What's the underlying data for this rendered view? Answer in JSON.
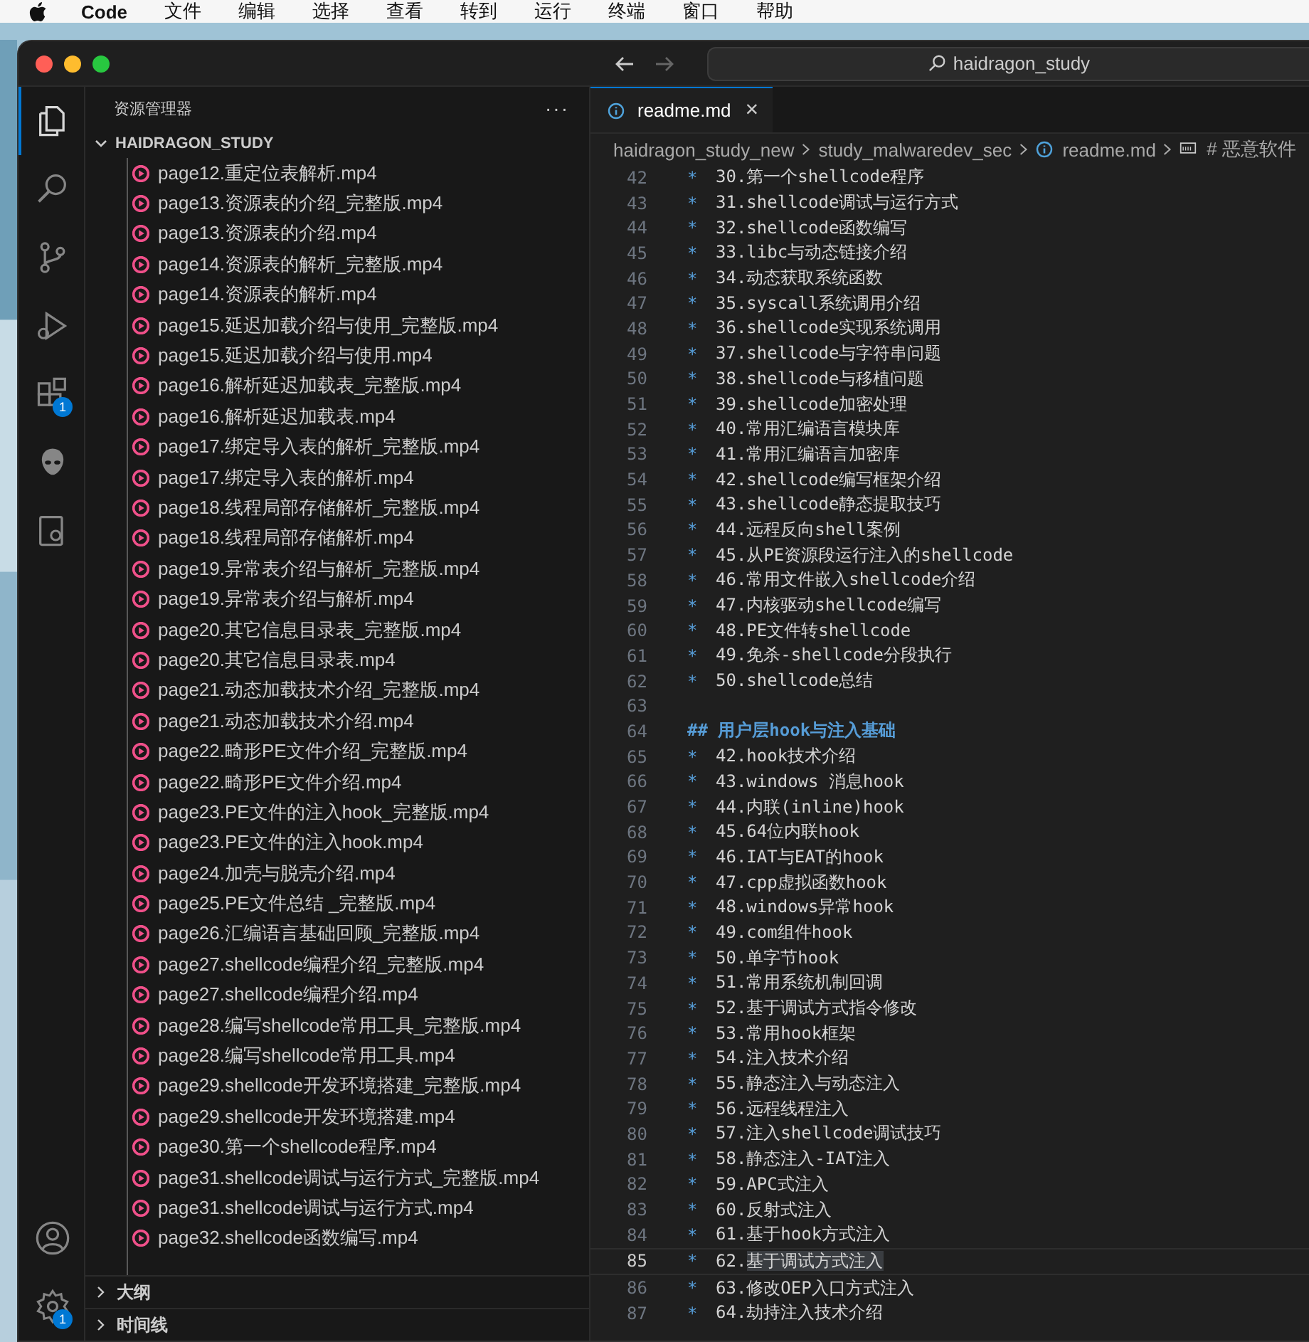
{
  "menu_bar": {
    "app": "Code",
    "items": [
      "文件",
      "编辑",
      "选择",
      "查看",
      "转到",
      "运行",
      "终端",
      "窗口",
      "帮助"
    ]
  },
  "title_bar": {
    "search": "haidragon_study"
  },
  "activity_bar": [
    {
      "kind": "explorer",
      "selected": true
    },
    {
      "kind": "search",
      "selected": false
    },
    {
      "kind": "source-control",
      "selected": false
    },
    {
      "kind": "run",
      "selected": false
    },
    {
      "kind": "extensions",
      "selected": false,
      "badge": "1"
    },
    {
      "kind": "alien",
      "selected": false
    },
    {
      "kind": "remote",
      "selected": false
    }
  ],
  "activity_bottom": [
    {
      "kind": "account"
    },
    {
      "kind": "settings",
      "badge": "1"
    }
  ],
  "sidebar": {
    "title": "资源管理器",
    "more": "···",
    "folder": "HAIDRAGON_STUDY",
    "files": [
      "page12.重定位表解析.mp4",
      "page13.资源表的介绍_完整版.mp4",
      "page13.资源表的介绍.mp4",
      "page14.资源表的解析_完整版.mp4",
      "page14.资源表的解析.mp4",
      "page15.延迟加载介绍与使用_完整版.mp4",
      "page15.延迟加载介绍与使用.mp4",
      "page16.解析延迟加载表_完整版.mp4",
      "page16.解析延迟加载表.mp4",
      "page17.绑定导入表的解析_完整版.mp4",
      "page17.绑定导入表的解析.mp4",
      "page18.线程局部存储解析_完整版.mp4",
      "page18.线程局部存储解析.mp4",
      "page19.异常表介绍与解析_完整版.mp4",
      "page19.异常表介绍与解析.mp4",
      "page20.其它信息目录表_完整版.mp4",
      "page20.其它信息目录表.mp4",
      "page21.动态加载技术介绍_完整版.mp4",
      "page21.动态加载技术介绍.mp4",
      "page22.畸形PE文件介绍_完整版.mp4",
      "page22.畸形PE文件介绍.mp4",
      "page23.PE文件的注入hook_完整版.mp4",
      "page23.PE文件的注入hook.mp4",
      "page24.加壳与脱壳介绍.mp4",
      "page25.PE文件总结 _完整版.mp4",
      "page26.汇编语言基础回顾_完整版.mp4",
      "page27.shellcode编程介绍_完整版.mp4",
      "page27.shellcode编程介绍.mp4",
      "page28.编写shellcode常用工具_完整版.mp4",
      "page28.编写shellcode常用工具.mp4",
      "page29.shellcode开发环境搭建_完整版.mp4",
      "page29.shellcode开发环境搭建.mp4",
      "page30.第一个shellcode程序.mp4",
      "page31.shellcode调试与运行方式_完整版.mp4",
      "page31.shellcode调试与运行方式.mp4",
      "page32.shellcode函数编写.mp4"
    ],
    "sections": [
      {
        "label": "大纲",
        "expanded": false
      },
      {
        "label": "时间线",
        "expanded": false
      }
    ]
  },
  "tab": {
    "label": "readme.md",
    "close": "×"
  },
  "breadcrumbs": [
    {
      "kind": "folder",
      "label": "haidragon_study_new"
    },
    {
      "kind": "folder",
      "label": "study_malwaredev_sec"
    },
    {
      "kind": "file",
      "label": "readme.md"
    },
    {
      "kind": "symbol",
      "label": "# 恶意软件"
    }
  ],
  "lines": [
    {
      "number": "42",
      "kind": "bullet",
      "marker": "*",
      "text": "30.第一个shellcode程序"
    },
    {
      "number": "43",
      "kind": "bullet",
      "marker": "*",
      "text": "31.shellcode调试与运行方式"
    },
    {
      "number": "44",
      "kind": "bullet",
      "marker": "*",
      "text": "32.shellcode函数编写"
    },
    {
      "number": "45",
      "kind": "bullet",
      "marker": "*",
      "text": "33.libc与动态链接介绍"
    },
    {
      "number": "46",
      "kind": "bullet",
      "marker": "*",
      "text": "34.动态获取系统函数"
    },
    {
      "number": "47",
      "kind": "bullet",
      "marker": "*",
      "text": "35.syscall系统调用介绍"
    },
    {
      "number": "48",
      "kind": "bullet",
      "marker": "*",
      "text": "36.shellcode实现系统调用"
    },
    {
      "number": "49",
      "kind": "bullet",
      "marker": "*",
      "text": "37.shellcode与字符串问题"
    },
    {
      "number": "50",
      "kind": "bullet",
      "marker": "*",
      "text": "38.shellcode与移植问题"
    },
    {
      "number": "51",
      "kind": "bullet",
      "marker": "*",
      "text": "39.shellcode加密处理"
    },
    {
      "number": "52",
      "kind": "bullet",
      "marker": "*",
      "text": "40.常用汇编语言模块库"
    },
    {
      "number": "53",
      "kind": "bullet",
      "marker": "*",
      "text": "41.常用汇编语言加密库"
    },
    {
      "number": "54",
      "kind": "bullet",
      "marker": "*",
      "text": "42.shellcode编写框架介绍"
    },
    {
      "number": "55",
      "kind": "bullet",
      "marker": "*",
      "text": "43.shellcode静态提取技巧"
    },
    {
      "number": "56",
      "kind": "bullet",
      "marker": "*",
      "text": "44.远程反向shell案例"
    },
    {
      "number": "57",
      "kind": "bullet",
      "marker": "*",
      "text": "45.从PE资源段运行注入的shellcode"
    },
    {
      "number": "58",
      "kind": "bullet",
      "marker": "*",
      "text": "46.常用文件嵌入shellcode介绍"
    },
    {
      "number": "59",
      "kind": "bullet",
      "marker": "*",
      "text": "47.内核驱动shellcode编写"
    },
    {
      "number": "60",
      "kind": "bullet",
      "marker": "*",
      "text": "48.PE文件转shellcode"
    },
    {
      "number": "61",
      "kind": "bullet",
      "marker": "*",
      "text": "49.免杀-shellcode分段执行"
    },
    {
      "number": "62",
      "kind": "bullet",
      "marker": "*",
      "text": "50.shellcode总结"
    },
    {
      "number": "63",
      "kind": "blank"
    },
    {
      "number": "64",
      "kind": "heading",
      "marker": "##",
      "text": "用户层hook与注入基础"
    },
    {
      "number": "65",
      "kind": "bullet",
      "marker": "*",
      "text": "42.hook技术介绍"
    },
    {
      "number": "66",
      "kind": "bullet",
      "marker": "*",
      "text": "43.windows 消息hook"
    },
    {
      "number": "67",
      "kind": "bullet",
      "marker": "*",
      "text": "44.内联(inline)hook"
    },
    {
      "number": "68",
      "kind": "bullet",
      "marker": "*",
      "text": "45.64位内联hook"
    },
    {
      "number": "69",
      "kind": "bullet",
      "marker": "*",
      "text": "46.IAT与EAT的hook"
    },
    {
      "number": "70",
      "kind": "bullet",
      "marker": "*",
      "text": "47.cpp虚拟函数hook"
    },
    {
      "number": "71",
      "kind": "bullet",
      "marker": "*",
      "text": "48.windows异常hook"
    },
    {
      "number": "72",
      "kind": "bullet",
      "marker": "*",
      "text": "49.com组件hook"
    },
    {
      "number": "73",
      "kind": "bullet",
      "marker": "*",
      "text": "50.单字节hook"
    },
    {
      "number": "74",
      "kind": "bullet",
      "marker": "*",
      "text": "51.常用系统机制回调"
    },
    {
      "number": "75",
      "kind": "bullet",
      "marker": "*",
      "text": "52.基于调试方式指令修改"
    },
    {
      "number": "76",
      "kind": "bullet",
      "marker": "*",
      "text": "53.常用hook框架"
    },
    {
      "number": "77",
      "kind": "bullet",
      "marker": "*",
      "text": "54.注入技术介绍"
    },
    {
      "number": "78",
      "kind": "bullet",
      "marker": "*",
      "text": "55.静态注入与动态注入"
    },
    {
      "number": "79",
      "kind": "bullet",
      "marker": "*",
      "text": "56.远程线程注入"
    },
    {
      "number": "80",
      "kind": "bullet",
      "marker": "*",
      "text": "57.注入shellcode调试技巧"
    },
    {
      "number": "81",
      "kind": "bullet",
      "marker": "*",
      "text": "58.静态注入-IAT注入"
    },
    {
      "number": "82",
      "kind": "bullet",
      "marker": "*",
      "text": "59.APC式注入"
    },
    {
      "number": "83",
      "kind": "bullet",
      "marker": "*",
      "text": "60.反射式注入"
    },
    {
      "number": "84",
      "kind": "bullet",
      "marker": "*",
      "text": "61.基于hook方式注入"
    },
    {
      "number": "85",
      "kind": "bullet",
      "marker": "*",
      "text": "62.",
      "selected_text": "基于调试方式注入",
      "current": true
    },
    {
      "number": "86",
      "kind": "bullet",
      "marker": "*",
      "text": "63.修改OEP入口方式注入"
    },
    {
      "number": "87",
      "kind": "bullet",
      "marker": "*",
      "text": "64.劫持注入技术介绍"
    }
  ]
}
